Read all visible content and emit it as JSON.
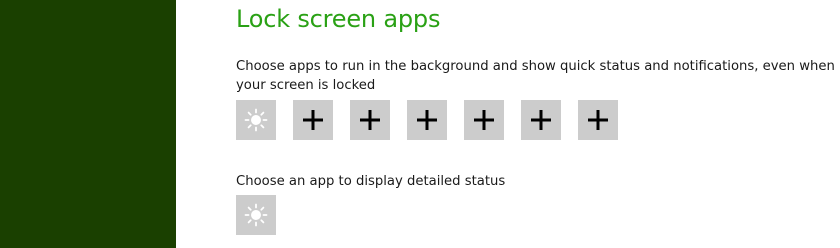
{
  "lock_screen": {
    "title": "Lock screen apps",
    "description": "Choose apps to run in the background and show quick status and notifications, even when your screen is locked",
    "app_slots": [
      {
        "icon": "weather-sun-icon",
        "state": "assigned"
      },
      {
        "icon": "plus-icon",
        "state": "empty"
      },
      {
        "icon": "plus-icon",
        "state": "empty"
      },
      {
        "icon": "plus-icon",
        "state": "empty"
      },
      {
        "icon": "plus-icon",
        "state": "empty"
      },
      {
        "icon": "plus-icon",
        "state": "empty"
      },
      {
        "icon": "plus-icon",
        "state": "empty"
      }
    ],
    "detailed_status_label": "Choose an app to display detailed status",
    "detailed_status_slot": {
      "icon": "weather-sun-icon",
      "state": "assigned"
    }
  },
  "colors": {
    "accent": "#2aa115",
    "sidebar": "#1a4000",
    "tile": "#cccccc"
  }
}
